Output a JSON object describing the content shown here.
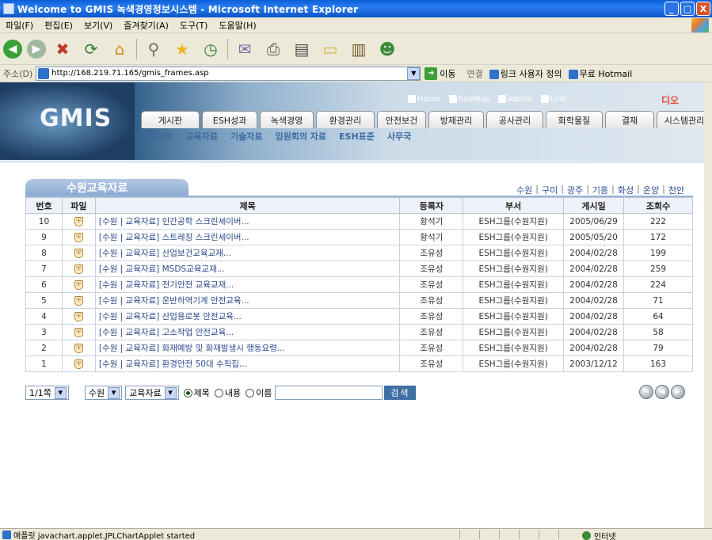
{
  "window": {
    "title": "Welcome to GMIS 녹색경영정보시스템 - Microsoft Internet Explorer",
    "buttons": {
      "minimize": "_",
      "maximize": "□",
      "close": "X"
    }
  },
  "menu": [
    "파일(F)",
    "편집(E)",
    "보기(V)",
    "즐겨찾기(A)",
    "도구(T)",
    "도움말(H)"
  ],
  "address": {
    "label": "주소(D)",
    "url": "http://168.219.71.165/gmis_frames.asp",
    "go_label": "이동",
    "links_label": "연결",
    "link1": "링크 사용자 정의",
    "link2": "무료 Hotmail"
  },
  "header": {
    "logo": "GMIS",
    "top_links": [
      "Home",
      "SiteMap",
      "Admin",
      "Link"
    ],
    "brand_mark": "디오",
    "nav_tabs": [
      "게시판",
      "ESH성과",
      "녹색경영",
      "환경관리",
      "안전보건",
      "방재관리",
      "공사관리",
      "화학물질",
      "결재",
      "시스템관리"
    ],
    "sub_nav": [
      "공지사항",
      "교육자료",
      "기술자료",
      "임원회의 자료",
      "ESH표준",
      "사무국"
    ]
  },
  "board": {
    "section_title": "수원교육자료",
    "regions": [
      "수원",
      "구미",
      "광주",
      "기흥",
      "화성",
      "온양",
      "천안"
    ],
    "columns": [
      "번호",
      "파일",
      "제목",
      "등록자",
      "부서",
      "게시일",
      "조회수"
    ],
    "rows": [
      {
        "no": "10",
        "file": "⛨",
        "title": "[수원 | 교육자료] 인간공학 스크린세이버...",
        "author": "황석기",
        "dept": "ESH그룹(수원지원)",
        "date": "2005/06/29",
        "views": "222"
      },
      {
        "no": "9",
        "file": "⛨",
        "title": "[수원 | 교육자료] 스트레칭 스크린세이버...",
        "author": "황석기",
        "dept": "ESH그룹(수원지원)",
        "date": "2005/05/20",
        "views": "172"
      },
      {
        "no": "8",
        "file": "⛨",
        "title": "[수원 | 교육자료] 산업보건교육교재...",
        "author": "조유성",
        "dept": "ESH그룹(수원지원)",
        "date": "2004/02/28",
        "views": "199"
      },
      {
        "no": "7",
        "file": "⛨",
        "title": "[수원 | 교육자료] MSDS교육교재...",
        "author": "조유성",
        "dept": "ESH그룹(수원지원)",
        "date": "2004/02/28",
        "views": "259"
      },
      {
        "no": "6",
        "file": "⛨",
        "title": "[수원 | 교육자료] 전기안전 교육교재...",
        "author": "조유성",
        "dept": "ESH그룹(수원지원)",
        "date": "2004/02/28",
        "views": "224"
      },
      {
        "no": "5",
        "file": "⛨",
        "title": "[수원 | 교육자료] 운반하역기계 안전교육...",
        "author": "조유성",
        "dept": "ESH그룹(수원지원)",
        "date": "2004/02/28",
        "views": "71"
      },
      {
        "no": "4",
        "file": "⛨",
        "title": "[수원 | 교육자료] 산업용로봇 안전교육...",
        "author": "조유성",
        "dept": "ESH그룹(수원지원)",
        "date": "2004/02/28",
        "views": "64"
      },
      {
        "no": "3",
        "file": "⛨",
        "title": "[수원 | 교육자료] 고소작업 안전교육...",
        "author": "조유성",
        "dept": "ESH그룹(수원지원)",
        "date": "2004/02/28",
        "views": "58"
      },
      {
        "no": "2",
        "file": "⛨",
        "title": "[수원 | 교육자료] 화재예방 및 화재발생시 행동요령...",
        "author": "조유성",
        "dept": "ESH그룹(수원지원)",
        "date": "2004/02/28",
        "views": "79"
      },
      {
        "no": "1",
        "file": "⛨",
        "title": "[수원 | 교육자료] 환경안전 50대 수칙집...",
        "author": "조유성",
        "dept": "ESH그룹(수원지원)",
        "date": "2003/12/12",
        "views": "163"
      }
    ]
  },
  "search": {
    "page_select": "1/1쪽",
    "region_select": "수원",
    "category_select": "교육자료",
    "radio_title": "제목",
    "radio_content": "내용",
    "radio_name": "이름",
    "query": "",
    "button": "검색"
  },
  "status": {
    "text": "애플릿 javachart.applet.JPLChartApplet started",
    "zone": "인터넷"
  }
}
